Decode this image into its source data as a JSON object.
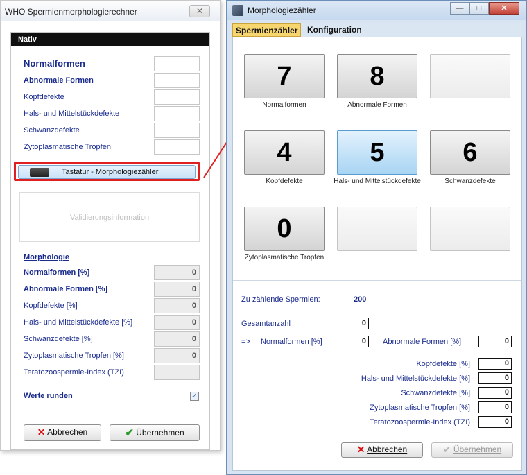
{
  "left_window": {
    "title": "WHO Spermienmorphologierechner",
    "close_glyph": "✕",
    "panel_header": "Nativ",
    "inputs": [
      {
        "label": "Normalformen",
        "style": "big"
      },
      {
        "label": "Abnormale Formen",
        "style": "bold"
      },
      {
        "label": "Kopfdefekte",
        "style": "normal"
      },
      {
        "label": "Hals- und Mittelstückdefekte",
        "style": "normal"
      },
      {
        "label": "Schwanzdefekte",
        "style": "normal"
      },
      {
        "label": "Zytoplasmatische Tropfen",
        "style": "normal"
      }
    ],
    "keyboard_button": "Tastatur - Morphologiezähler",
    "validation_text": "Validierungsinformation",
    "morphology_heading": "Morphologie",
    "results": [
      {
        "label": "Normalformen [%]",
        "value": "0",
        "bold": true
      },
      {
        "label": "Abnormale Formen [%]",
        "value": "0",
        "bold": true
      },
      {
        "label": "Kopfdefekte [%]",
        "value": "0",
        "bold": false
      },
      {
        "label": "Hals- und Mittelstückdefekte [%]",
        "value": "0",
        "bold": false
      },
      {
        "label": "Schwanzdefekte [%]",
        "value": "0",
        "bold": false
      },
      {
        "label": "Zytoplasmatische Tropfen [%]",
        "value": "0",
        "bold": false
      },
      {
        "label": "Teratozoospermie-Index (TZI)",
        "value": "",
        "bold": false
      }
    ],
    "round_label": "Werte runden",
    "round_checked": "✓",
    "cancel_label": "Abbrechen",
    "apply_label": "Übernehmen"
  },
  "right_window": {
    "title": "Morphologiezähler",
    "controls": {
      "minimize": "—",
      "maximize": "□",
      "close": "✕"
    },
    "tabs": [
      "Spermienzähler",
      "Konfiguration"
    ],
    "counter_buttons": [
      {
        "digit": "7",
        "caption": "Normalformen"
      },
      {
        "digit": "8",
        "caption": "Abnormale Formen"
      },
      {
        "digit": "",
        "caption": ""
      },
      {
        "digit": "4",
        "caption": "Kopfdefekte"
      },
      {
        "digit": "5",
        "caption": "Hals- und Mittelstückdefekte"
      },
      {
        "digit": "6",
        "caption": "Schwanzdefekte"
      },
      {
        "digit": "0",
        "caption": "Zytoplasmatische Tropfen"
      },
      {
        "digit": "",
        "caption": ""
      },
      {
        "digit": "",
        "caption": ""
      }
    ],
    "to_count_label": "Zu zählende Spermien:",
    "to_count_value": "200",
    "total_label": "Gesamtanzahl",
    "total_value": "0",
    "arrow_prefix": "=>",
    "normal_label": "Normalformen [%]",
    "normal_value": "0",
    "abnormal_label": "Abnormale Formen [%]",
    "abnormal_value": "0",
    "stats": [
      {
        "label": "Kopfdefekte [%]",
        "value": "0"
      },
      {
        "label": "Hals- und Mittelstückdefekte [%]",
        "value": "0"
      },
      {
        "label": "Schwanzdefekte [%]",
        "value": "0"
      },
      {
        "label": "Zytoplasmatische Tropfen [%]",
        "value": "0"
      },
      {
        "label": "Teratozoospermie-Index (TZI)",
        "value": "0"
      }
    ],
    "cancel_label": "Abbrechen",
    "apply_label": "Übernehmen"
  },
  "colors": {
    "accent_red": "#e02020",
    "label_blue": "#1a2b8c",
    "tab_active": "#f8d66f"
  }
}
